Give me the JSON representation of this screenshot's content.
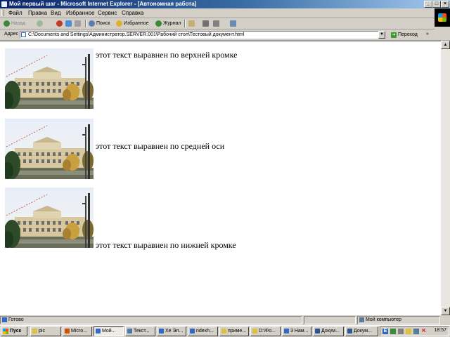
{
  "window": {
    "title": "Мой первый шаг - Microsoft Internet Explorer - [Автономная работа]",
    "buttons": [
      "_",
      "□",
      "×"
    ]
  },
  "menu": [
    "Файл",
    "Правка",
    "Вид",
    "Избранное",
    "Сервис",
    "Справка"
  ],
  "toolbar": {
    "back": "Назад",
    "search": "Поиск",
    "favorites": "Избранное",
    "history": "Журнал"
  },
  "address": {
    "label": "Адрес",
    "value": "C:\\Documents and Settings\\Администратор.SERVER.001\\Рабочий стол\\Тестовый документ.html",
    "go": "Переход",
    "links": "»"
  },
  "content": {
    "captions": [
      "этот текст выравнен по верхней кромке",
      "этот текст выравнен по средней оси",
      "этот текст выравнен по нижней кромке"
    ]
  },
  "status": {
    "left": "Готово",
    "zone": "Мой компьютер"
  },
  "taskbar": {
    "start": "Пуск",
    "tasks": [
      "pic",
      "Micro...",
      "Мой...",
      "Текст...",
      "Хе Эл...",
      "ndexh...",
      "приме...",
      "D:\\Фо...",
      "3 Нам...",
      "Докум...",
      "Докум..."
    ],
    "clock": "18:57"
  },
  "colors": {
    "titlebar_start": "#0a246a",
    "titlebar_end": "#a6caf0",
    "chrome": "#d4d0c8"
  }
}
